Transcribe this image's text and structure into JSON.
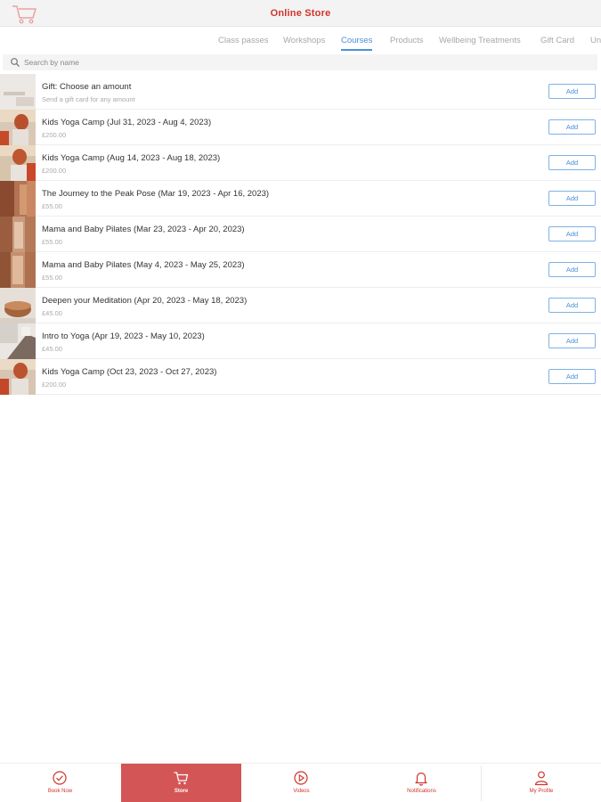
{
  "header": {
    "title": "Online Store",
    "cart_icon": "cart-icon",
    "accent_color": "#d0342c"
  },
  "tabs": [
    {
      "label": "Class passes",
      "active": false
    },
    {
      "label": "Workshops",
      "active": false
    },
    {
      "label": "Courses",
      "active": true
    },
    {
      "label": "Products",
      "active": false
    },
    {
      "label": "Wellbeing Treatments",
      "active": false
    },
    {
      "label": "Gift Card",
      "active": false
    },
    {
      "label": "Un",
      "active": false
    }
  ],
  "search": {
    "placeholder": "Search by name",
    "icon": "search-icon"
  },
  "items": [
    {
      "name": "Gift: Choose an amount",
      "subtitle": "Send a gift card for any amount",
      "add_label": "Add"
    },
    {
      "name": "Kids Yoga Camp (Jul 31, 2023 - Aug 4, 2023)",
      "subtitle": "£200.00",
      "add_label": "Add"
    },
    {
      "name": "Kids Yoga Camp (Aug 14, 2023 - Aug 18, 2023)",
      "subtitle": "£200.00",
      "add_label": "Add"
    },
    {
      "name": "The Journey to the Peak Pose (Mar 19, 2023 - Apr 16, 2023)",
      "subtitle": "£55.00",
      "add_label": "Add"
    },
    {
      "name": "Mama and Baby Pilates (Mar 23, 2023 - Apr 20, 2023)",
      "subtitle": "£55.00",
      "add_label": "Add"
    },
    {
      "name": "Mama and Baby Pilates (May 4, 2023 - May 25, 2023)",
      "subtitle": "£55.00",
      "add_label": "Add"
    },
    {
      "name": "Deepen your Meditation (Apr 20, 2023 - May 18, 2023)",
      "subtitle": "£45.00",
      "add_label": "Add"
    },
    {
      "name": "Intro to Yoga (Apr 19, 2023 - May 10, 2023)",
      "subtitle": "£45.00",
      "add_label": "Add"
    },
    {
      "name": "Kids Yoga Camp (Oct 23, 2023 - Oct 27, 2023)",
      "subtitle": "£200.00",
      "add_label": "Add"
    }
  ],
  "bottom_nav": [
    {
      "label": "Book Now",
      "icon": "check-circle-icon",
      "active": false
    },
    {
      "label": "Store",
      "icon": "cart-icon",
      "active": true
    },
    {
      "label": "Videos",
      "icon": "play-circle-icon",
      "active": false
    },
    {
      "label": "Notifications",
      "icon": "bell-icon",
      "active": false
    },
    {
      "label": "My Profile",
      "icon": "person-icon",
      "active": false
    }
  ]
}
